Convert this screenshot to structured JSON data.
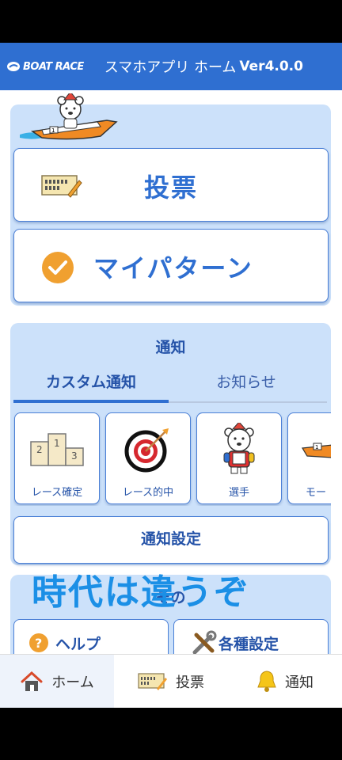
{
  "header": {
    "logo_text": "BOAT RACE",
    "title": "スマホアプリ  ホーム",
    "version": "Ver4.0.0"
  },
  "main": {
    "vote_label": "投票",
    "my_pattern_label": "マイパターン"
  },
  "notice": {
    "title": "通知",
    "tabs": [
      {
        "label": "カスタム通知",
        "active": true
      },
      {
        "label": "お知らせ",
        "active": false
      }
    ],
    "cards": [
      {
        "label": "レース確定",
        "icon": "podium-icon"
      },
      {
        "label": "レース的中",
        "icon": "target-icon"
      },
      {
        "label": "選手",
        "icon": "bear-racer-icon"
      },
      {
        "label": "モー",
        "icon": "boat-icon"
      }
    ],
    "settings_label": "通知設定"
  },
  "other": {
    "title": "その",
    "help_label": "ヘルプ",
    "settings_label": "各種設定"
  },
  "overlay_text": "時代は違うぞ",
  "bottom_nav": [
    {
      "label": "ホーム",
      "icon": "home-icon",
      "active": true
    },
    {
      "label": "投票",
      "icon": "ticket-icon",
      "active": false
    },
    {
      "label": "通知",
      "icon": "bell-icon",
      "active": false
    }
  ],
  "colors": {
    "brand": "#2f6fd1",
    "panel": "#cce1fa",
    "accent_orange": "#f0a030",
    "overlay": "#1b8fe6"
  }
}
